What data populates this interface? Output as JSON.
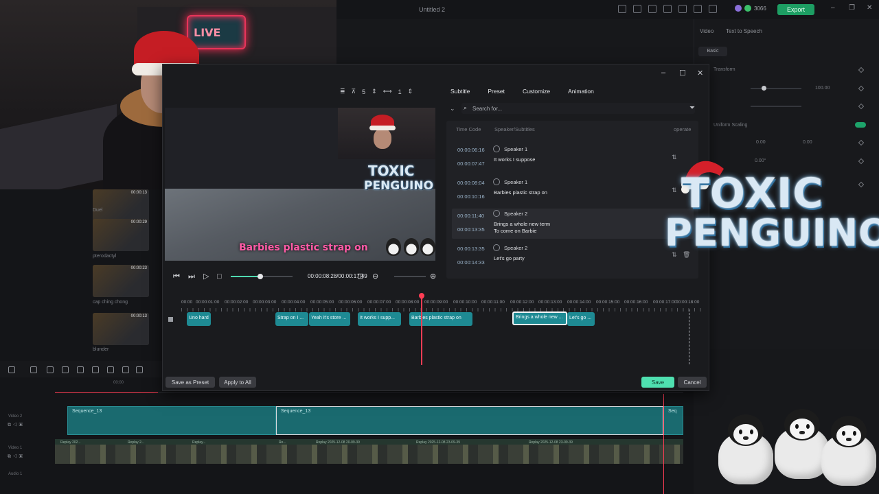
{
  "app": {
    "title": "Untitled 2",
    "credits": "3066",
    "export_label": "Export",
    "right_tabs": [
      "Video",
      "Text to Speech"
    ],
    "basic_label": "Basic",
    "transform_label": "Transform",
    "scale_value": "100.00",
    "scaling_label": "Uniform Scaling",
    "position_x": "0.00",
    "position_y": "0.00",
    "rotate_value": "0.00°"
  },
  "webcam": {
    "neon_text": "LIVE"
  },
  "media_items": [
    {
      "name": "Duel",
      "duration": "00:00:13"
    },
    {
      "name": "pterodactyl",
      "duration": "00:00:29"
    },
    {
      "name": "cap ching chong",
      "duration": "00:00:23"
    },
    {
      "name": "blunder",
      "duration": "00:00:13"
    }
  ],
  "dialog": {
    "toolbar": {
      "size_value": "5",
      "spacing_value": "1"
    },
    "preview": {
      "subtitle_text": "Barbies plastic strap on",
      "logo_line1": "TOXIC",
      "logo_line2": "PENGUINO"
    },
    "playback": {
      "time": "00:00:08:28/00:00:17:49"
    },
    "tabs": [
      "Subtitle",
      "Preset",
      "Customize",
      "Animation"
    ],
    "search_placeholder": "Search for...",
    "list_headers": {
      "time_code": "Time Code",
      "speaker": "Speaker/Subtitles",
      "operate": "operate"
    },
    "rows": [
      {
        "start": "00:00:06:16",
        "end": "00:00:07:47",
        "speaker": "Speaker 1",
        "text": [
          "It works I suppose"
        ]
      },
      {
        "start": "00:00:08:04",
        "end": "00:00:10:16",
        "speaker": "Speaker 1",
        "text": [
          "Barbies plastic strap on"
        ]
      },
      {
        "start": "00:00:11:40",
        "end": "00:00:13:35",
        "speaker": "Speaker 2",
        "text": [
          "Brings a whole new term",
          "To come on Barbie"
        ]
      },
      {
        "start": "00:00:13:35",
        "end": "00:00:14:33",
        "speaker": "Speaker 2",
        "text": [
          "Let's go party"
        ]
      }
    ],
    "ruler_labels": [
      "00:00",
      "00:00:01:00",
      "00:00:02:00",
      "00:00:03:00",
      "00:00:04:00",
      "00:00:05:00",
      "00:00:06:00",
      "00:00:07:00",
      "00:00:08:00",
      "00:00:09:00",
      "00:00:10:00",
      "00:00:11:00",
      "00:00:12:00",
      "00:00:13:00",
      "00:00:14:00",
      "00:00:15:00",
      "00:00:16:00",
      "00:00:17:00",
      "00:00:18:00"
    ],
    "clips": [
      "Uno hard",
      "Strap on I ...",
      "Yeah it's store ...",
      "It works I supp...",
      "Barbies plastic strap on",
      "Brings a whole new ...",
      "Let's go ..."
    ],
    "buttons": {
      "save_preset": "Save as Preset",
      "apply_all": "Apply to All",
      "save": "Save",
      "cancel": "Cancel"
    }
  },
  "main_timeline": {
    "ruler_label": "00:00",
    "track_video2": "Video 2",
    "track_video1": "Video 1",
    "track_audio1": "Audio 1",
    "sequence_a": "Sequence_13",
    "sequence_b": "Sequence_13",
    "sequence_c": "Seq",
    "film_labels": [
      "Replay 202...",
      "Replay 2...",
      "Replay...",
      "Re...",
      "Replay 2025-12-08 20-09-39",
      "Replay 2025-12-08 23-09-39",
      "Replay 2025-12-08 23-09-39"
    ]
  },
  "overlay": {
    "logo_line1": "TOXIC",
    "logo_line2": "PENGUINO"
  },
  "colors": {
    "accent_green": "#4fe0b0",
    "clip_teal": "#1e8a93",
    "playhead_red": "#ff3d54",
    "subtitle_pink": "#ff5aa6"
  }
}
